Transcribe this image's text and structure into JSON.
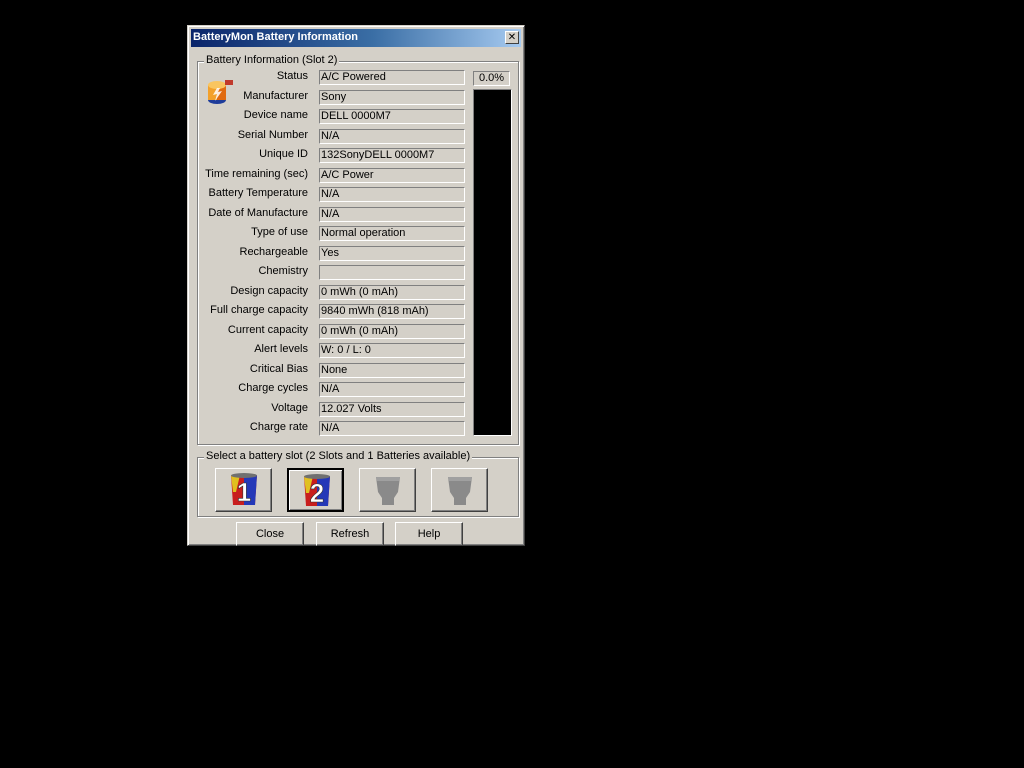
{
  "window": {
    "title": "BatteryMon Battery Information",
    "close_glyph": "✕"
  },
  "info_group": {
    "title": "Battery Information (Slot 2)",
    "percent": "0.0%",
    "charge_level_percent": 0,
    "fields": [
      {
        "label": "Status",
        "value": "A/C Powered"
      },
      {
        "label": "Manufacturer",
        "value": "Sony"
      },
      {
        "label": "Device name",
        "value": "DELL 0000M7"
      },
      {
        "label": "Serial Number",
        "value": "N/A"
      },
      {
        "label": "Unique ID",
        "value": "132SonyDELL 0000M7"
      },
      {
        "label": "Time remaining (sec)",
        "value": "A/C Power"
      },
      {
        "label": "Battery Temperature",
        "value": "N/A"
      },
      {
        "label": "Date of Manufacture",
        "value": "N/A"
      },
      {
        "label": "Type of use",
        "value": "Normal operation"
      },
      {
        "label": "Rechargeable",
        "value": "Yes"
      },
      {
        "label": "Chemistry",
        "value": ""
      },
      {
        "label": "Design capacity",
        "value": "0 mWh (0 mAh)"
      },
      {
        "label": "Full charge capacity",
        "value": "9840 mWh (818 mAh)"
      },
      {
        "label": "Current capacity",
        "value": "0 mWh (0 mAh)"
      },
      {
        "label": "Alert levels",
        "value": "W: 0 / L: 0"
      },
      {
        "label": "Critical Bias",
        "value": "None"
      },
      {
        "label": "Charge cycles",
        "value": "N/A"
      },
      {
        "label": "Voltage",
        "value": "12.027 Volts"
      },
      {
        "label": "Charge rate",
        "value": "N/A"
      }
    ]
  },
  "slot_group": {
    "title": "Select a battery slot (2 Slots and 1 Batteries available)",
    "slots": [
      {
        "number": "1",
        "available": true,
        "selected": false
      },
      {
        "number": "2",
        "available": true,
        "selected": true
      },
      {
        "number": "",
        "available": false,
        "selected": false
      },
      {
        "number": "",
        "available": false,
        "selected": false
      }
    ]
  },
  "buttons": {
    "close": "Close",
    "refresh": "Refresh",
    "help": "Help"
  },
  "colors": {
    "desktop": "#000000",
    "face": "#d4d0c8",
    "title_start": "#0a246a",
    "meter_bg": "#000000"
  }
}
